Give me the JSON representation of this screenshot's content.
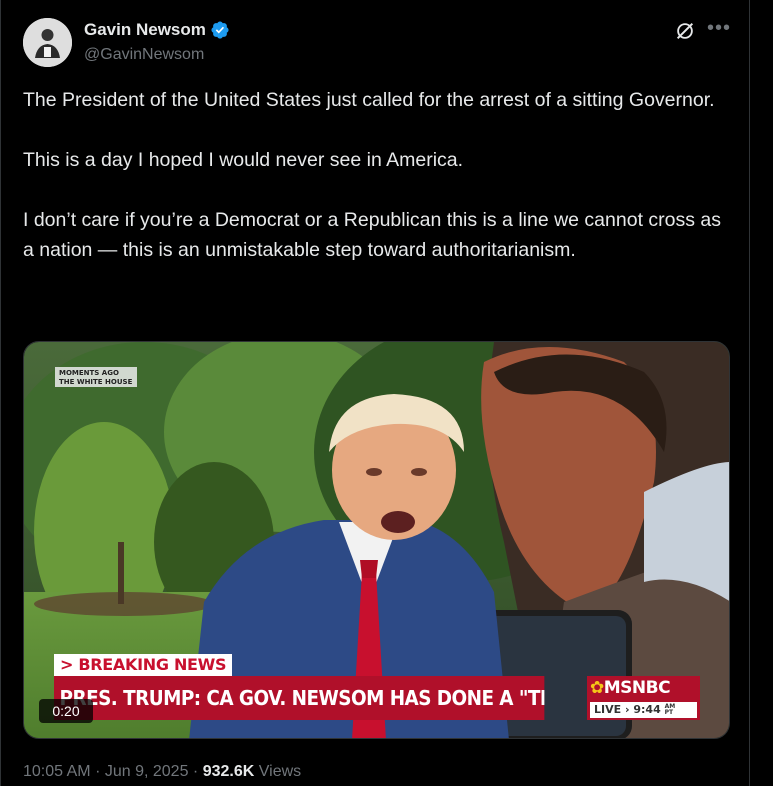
{
  "author": {
    "name": "Gavin Newsom",
    "handle": "@GavinNewsom",
    "verified": true,
    "verified_color": "#1d9bf0"
  },
  "icons": [
    "grok-icon",
    "more-icon",
    "verified-badge-icon",
    "avatar"
  ],
  "tweet": {
    "paragraphs": [
      "The President of the United States just called for the arrest of a sitting Governor.",
      "This is a day I hoped I would never see in America.",
      "I don’t care if you’re a Democrat or a Republican this is a line we cannot cross as a nation — this is an unmistakable step toward authoritarianism."
    ]
  },
  "video": {
    "corner_tag_line1": "MOMENTS AGO",
    "corner_tag_line2": "THE WHITE HOUSE",
    "breaking_label": "> BREAKING NEWS",
    "headline": "PRES. TRUMP: CA GOV. NEWSOM HAS DONE A \"TERRIBLE JOB\"",
    "network": "MSNBC",
    "live_label": "LIVE",
    "live_time": "9:44",
    "live_time_suffix_top": "AM",
    "live_time_suffix_bottom": "PT",
    "duration": "0:20"
  },
  "meta": {
    "time": "10:05 AM",
    "separator": "·",
    "date": "Jun 9, 2025",
    "views_count": "932.6K",
    "views_label": "Views"
  },
  "colors": {
    "background": "#000000",
    "text": "#e7e9ea",
    "secondary_text": "#71767b",
    "border": "#2f3336",
    "chyron_red": "#b0102a"
  }
}
